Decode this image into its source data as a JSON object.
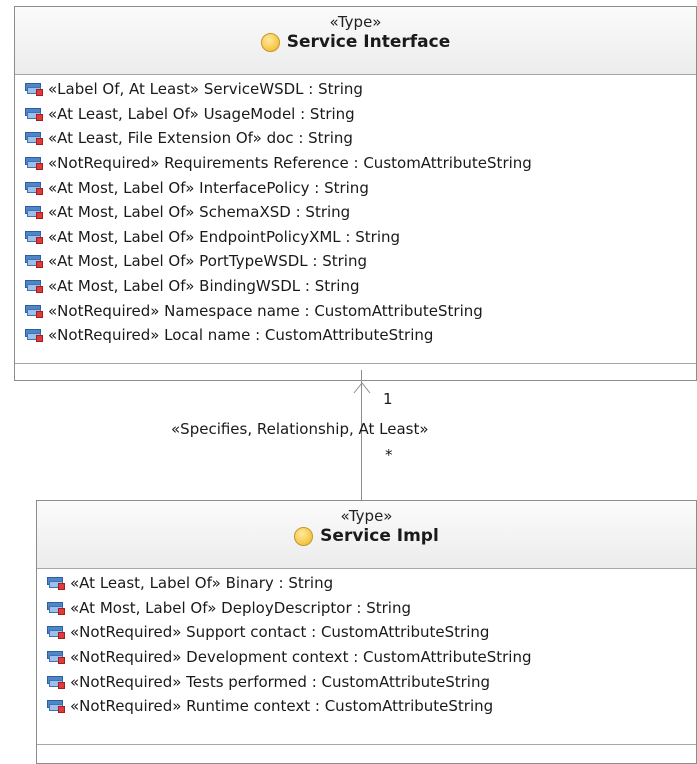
{
  "service_interface": {
    "stereotype": "«Type»",
    "name": "Service Interface",
    "attributes": [
      "«Label Of, At Least» ServiceWSDL : String",
      "«At Least, Label Of» UsageModel : String",
      "«At Least, File Extension Of» doc : String",
      "«NotRequired» Requirements Reference : CustomAttributeString",
      "«At Most, Label Of» InterfacePolicy : String",
      "«At Most, Label Of» SchemaXSD : String",
      "«At Most, Label Of» EndpointPolicyXML : String",
      "«At Most, Label Of» PortTypeWSDL : String",
      "«At Most, Label Of» BindingWSDL : String",
      "«NotRequired» Namespace name : CustomAttributeString",
      "«NotRequired» Local name : CustomAttributeString"
    ]
  },
  "association": {
    "stereotype": "«Specifies, Relationship, At Least»",
    "target_multiplicity": "1",
    "source_multiplicity": "*"
  },
  "service_impl": {
    "stereotype": "«Type»",
    "name": "Service Impl",
    "attributes": [
      "«At Least, Label Of» Binary : String",
      "«At Most, Label Of» DeployDescriptor : String",
      "«NotRequired» Support contact : CustomAttributeString",
      "«NotRequired» Development context : CustomAttributeString",
      "«NotRequired» Tests performed : CustomAttributeString",
      "«NotRequired» Runtime context : CustomAttributeString"
    ]
  },
  "icons": {
    "class_icon": "class-circle-icon",
    "attribute_icon": "private-attribute-icon"
  }
}
